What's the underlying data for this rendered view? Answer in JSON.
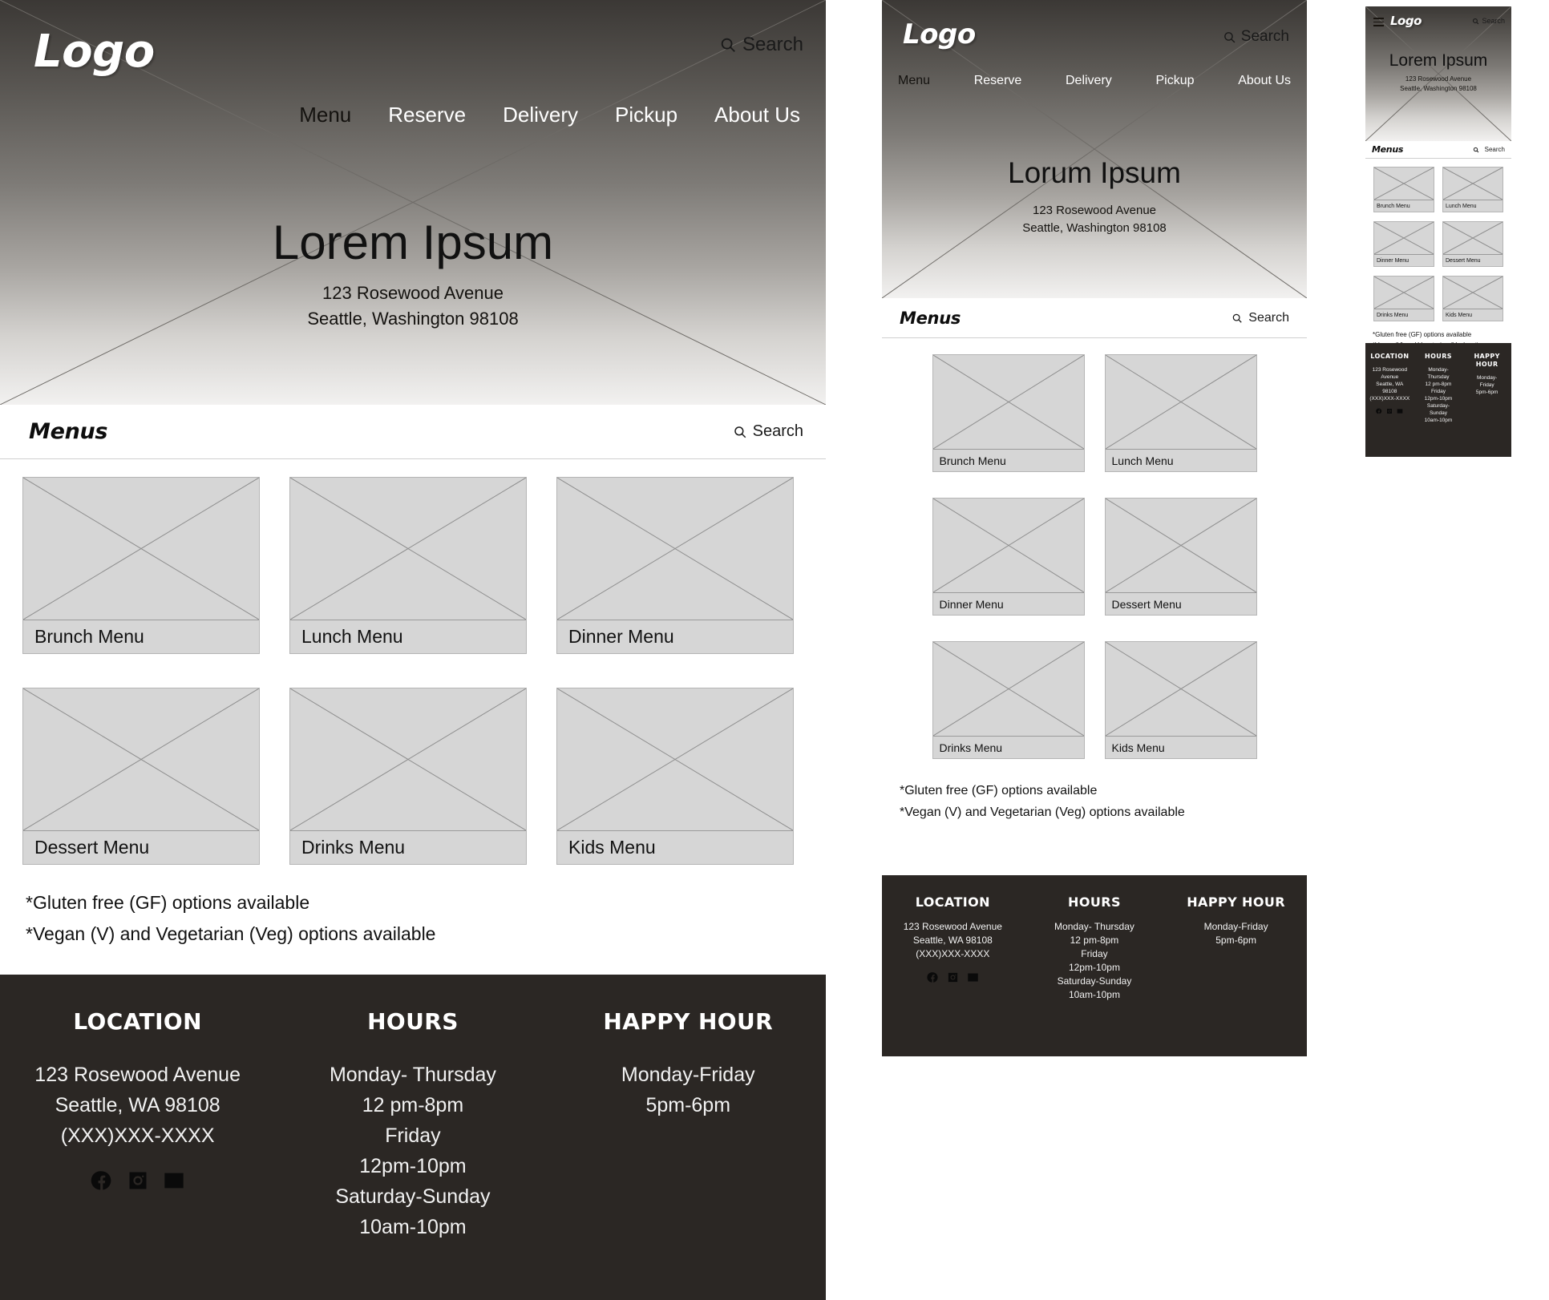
{
  "brand": {
    "logo": "Logo"
  },
  "search": {
    "label": "Search",
    "icon": "search-icon"
  },
  "nav": {
    "items": [
      {
        "label": "Menu",
        "active": true
      },
      {
        "label": "Reserve",
        "active": false
      },
      {
        "label": "Delivery",
        "active": false
      },
      {
        "label": "Pickup",
        "active": false
      },
      {
        "label": "About Us",
        "active": false
      }
    ]
  },
  "hero": {
    "title_desktop": "Lorem Ipsum",
    "title_tablet": "Lorum Ipsum",
    "title_mobile": "Lorem Ipsum",
    "address_line1": "123 Rosewood Avenue",
    "address_line2": "Seattle, Washington 98108"
  },
  "menus": {
    "section_title": "Menus",
    "cards": [
      {
        "label": "Brunch Menu"
      },
      {
        "label": "Lunch Menu"
      },
      {
        "label": "Dinner Menu"
      },
      {
        "label": "Dessert Menu"
      },
      {
        "label": "Drinks Menu"
      },
      {
        "label": "Kids Menu"
      }
    ],
    "notes": [
      "*Gluten free (GF) options available",
      "*Vegan (V) and Vegetarian (Veg) options available"
    ]
  },
  "footer": {
    "location": {
      "heading": "LOCATION",
      "heading_mobile": "LOCATION",
      "lines": [
        "123 Rosewood Avenue",
        "Seattle, WA 98108",
        "(XXX)XXX-XXXX"
      ],
      "lines_mobile": [
        "123 Rosewood",
        "Avenue",
        "Seattle, WA",
        "98108",
        "(XXX)XXX-XXXX"
      ],
      "socials": [
        "facebook-icon",
        "instagram-icon",
        "email-icon"
      ]
    },
    "hours": {
      "heading": "HOURS",
      "lines": [
        "Monday- Thursday",
        "12 pm-8pm",
        "Friday",
        "12pm-10pm",
        "Saturday-Sunday",
        "10am-10pm"
      ],
      "lines_mobile": [
        "Monday-",
        "Thursday",
        "12 pm-8pm",
        "Friday",
        "12pm-10pm",
        "Saturday-",
        "Sunday",
        "10am-10pm"
      ]
    },
    "happy_hour": {
      "heading": "HAPPY HOUR",
      "heading_mobile_line1": "HAPPY",
      "heading_mobile_line2": "HOUR",
      "lines": [
        "Monday-Friday",
        "5pm-6pm"
      ],
      "lines_mobile": [
        "Monday-",
        "Friday",
        "5pm-6pm"
      ]
    }
  },
  "colors": {
    "footer_bg": "#2b2724",
    "card_fill": "#d6d6d6",
    "card_stroke": "#8e8e8e",
    "hero_top": "#3b3835",
    "hero_bottom": "#f2f1f0",
    "nav_active": "#14120f",
    "nav_inactive": "#ffffff"
  },
  "breakpoints": {
    "desktop": "desktop-wireframe",
    "tablet": "tablet-wireframe",
    "mobile": "mobile-wireframe"
  }
}
